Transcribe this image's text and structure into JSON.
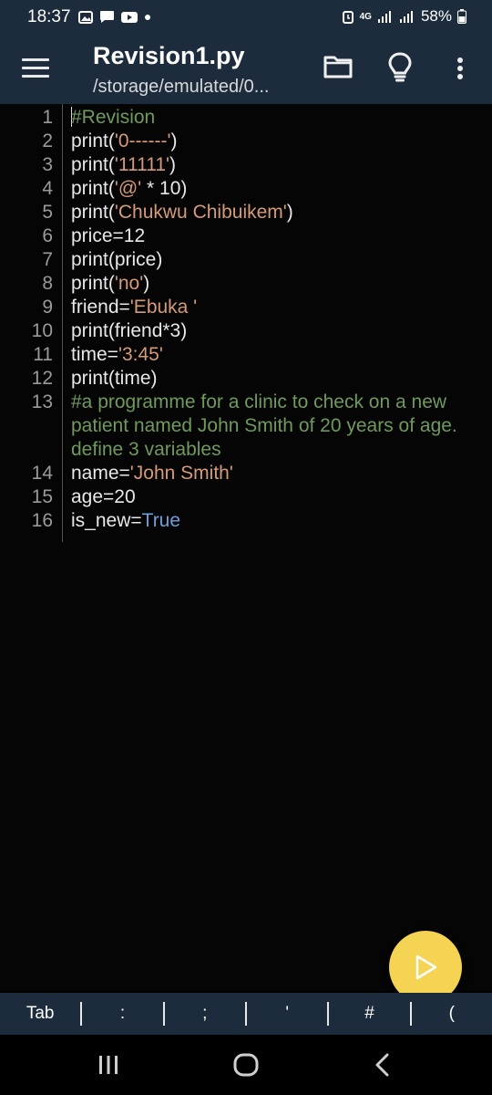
{
  "status_bar": {
    "time": "18:37",
    "network": "4G",
    "battery": "58%"
  },
  "app_bar": {
    "title": "Revision1.py",
    "path": "/storage/emulated/0..."
  },
  "editor": {
    "lines": [
      {
        "num": "1",
        "parts": [
          {
            "t": "#Revision",
            "c": "cmt"
          }
        ]
      },
      {
        "num": "2",
        "parts": [
          {
            "t": "print(",
            "c": ""
          },
          {
            "t": "'0------'",
            "c": "str"
          },
          {
            "t": ")",
            "c": ""
          }
        ]
      },
      {
        "num": "3",
        "parts": [
          {
            "t": "print(",
            "c": ""
          },
          {
            "t": "'11111'",
            "c": "str"
          },
          {
            "t": ")",
            "c": ""
          }
        ]
      },
      {
        "num": "4",
        "parts": [
          {
            "t": "print(",
            "c": ""
          },
          {
            "t": "'@'",
            "c": "str"
          },
          {
            "t": " * 10)",
            "c": ""
          }
        ]
      },
      {
        "num": "5",
        "parts": [
          {
            "t": "print(",
            "c": ""
          },
          {
            "t": "'Chukwu Chibuikem'",
            "c": "str"
          },
          {
            "t": ")",
            "c": ""
          }
        ]
      },
      {
        "num": "6",
        "parts": [
          {
            "t": "price=12",
            "c": ""
          }
        ]
      },
      {
        "num": "7",
        "parts": [
          {
            "t": "print(price)",
            "c": ""
          }
        ]
      },
      {
        "num": "8",
        "parts": [
          {
            "t": "print(",
            "c": ""
          },
          {
            "t": "'no'",
            "c": "str"
          },
          {
            "t": ")",
            "c": ""
          }
        ]
      },
      {
        "num": "9",
        "parts": [
          {
            "t": "friend=",
            "c": ""
          },
          {
            "t": "'Ebuka '",
            "c": "str"
          }
        ]
      },
      {
        "num": "10",
        "parts": [
          {
            "t": "print(friend*3)",
            "c": ""
          }
        ]
      },
      {
        "num": "11",
        "parts": [
          {
            "t": "time=",
            "c": ""
          },
          {
            "t": "'3:45'",
            "c": "str"
          }
        ]
      },
      {
        "num": "12",
        "parts": [
          {
            "t": "print(time)",
            "c": ""
          }
        ]
      },
      {
        "num": "13",
        "wrap": true,
        "parts": [
          {
            "t": "#a programme for a clinic to check on a new patient named John Smith of 20 years of age. define 3 variables",
            "c": "cmt"
          }
        ]
      },
      {
        "num": "14",
        "parts": [
          {
            "t": "name=",
            "c": ""
          },
          {
            "t": "'John Smith'",
            "c": "str"
          }
        ]
      },
      {
        "num": "15",
        "parts": [
          {
            "t": "age=20",
            "c": ""
          }
        ]
      },
      {
        "num": "16",
        "parts": [
          {
            "t": "is_new=",
            "c": ""
          },
          {
            "t": "True",
            "c": "kw"
          }
        ]
      }
    ]
  },
  "symbol_bar": {
    "keys": [
      "Tab",
      ":",
      ";",
      "'",
      "#",
      "("
    ]
  },
  "colors": {
    "bar_bg": "#1c2c3c",
    "comment": "#6f9a5b",
    "string": "#d59a78",
    "keyword": "#6f9fd8",
    "fab": "#f5d453"
  },
  "icons": [
    "menu-icon",
    "folder-icon",
    "lightbulb-icon",
    "more-vert-icon",
    "play-icon",
    "nav-recents-icon",
    "nav-home-icon",
    "nav-back-icon"
  ]
}
